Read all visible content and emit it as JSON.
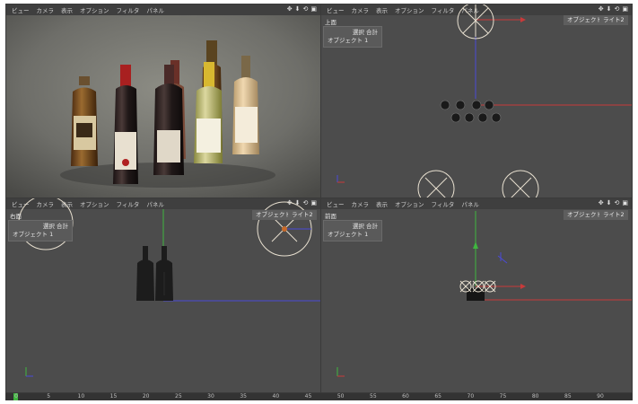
{
  "viewport_menu": [
    "ビュー",
    "カメラ",
    "表示",
    "オプション",
    "フィルタ",
    "パネル"
  ],
  "viewport_icons": [
    "move-icon",
    "down-arrow-icon",
    "rotate-icon",
    "maximize-icon"
  ],
  "viewports": {
    "perspective": {},
    "top": {
      "name": "上面"
    },
    "right": {
      "name": "右面"
    },
    "front": {
      "name": "前面"
    }
  },
  "hud": {
    "total_label": "選択 合計",
    "object_label": "オブジェクト",
    "object_count": "1"
  },
  "chips": {
    "objects": "オブジェクト",
    "lights": "ライト2"
  },
  "timeline": {
    "ticks": [
      "0",
      "5",
      "10",
      "15",
      "20",
      "25",
      "30",
      "35",
      "40",
      "45",
      "50",
      "55",
      "60",
      "65",
      "70",
      "75",
      "80",
      "85",
      "90"
    ]
  },
  "colors": {
    "viewport_bg": "#4c4c4c",
    "axis_x": "#c83a3a",
    "axis_y": "#3fb63f",
    "axis_z": "#4a4ad6"
  }
}
